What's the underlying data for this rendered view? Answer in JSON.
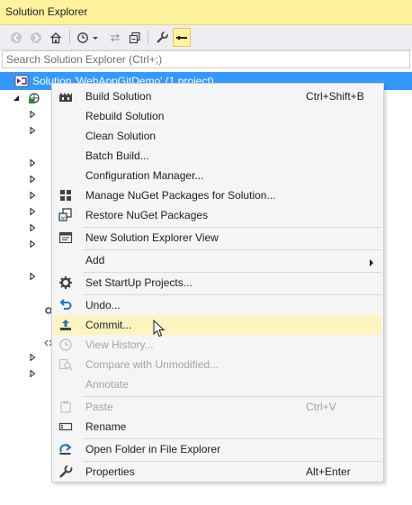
{
  "window": {
    "title": "Solution Explorer"
  },
  "search": {
    "placeholder": "Search Solution Explorer (Ctrl+;)"
  },
  "tree": {
    "root_label": "Solution 'WebAppGitDemo' (1 project)"
  },
  "toolbar": {
    "buttons": [
      "back-icon",
      "forward-icon",
      "home-icon",
      "history-icon",
      "sync-icon",
      "collapse-all-icon",
      "properties-icon",
      "pin-icon"
    ]
  },
  "menu": {
    "items": [
      {
        "label": "Build Solution",
        "shortcut": "Ctrl+Shift+B",
        "icon": "build-icon",
        "enabled": true
      },
      {
        "label": "Rebuild Solution",
        "shortcut": "",
        "icon": "",
        "enabled": true
      },
      {
        "label": "Clean Solution",
        "shortcut": "",
        "icon": "",
        "enabled": true
      },
      {
        "label": "Batch Build...",
        "shortcut": "",
        "icon": "",
        "enabled": true
      },
      {
        "label": "Configuration Manager...",
        "shortcut": "",
        "icon": "",
        "enabled": true
      },
      {
        "label": "Manage NuGet Packages for Solution...",
        "shortcut": "",
        "icon": "nuget-icon",
        "enabled": true
      },
      {
        "label": "Restore NuGet Packages",
        "shortcut": "",
        "icon": "restore-icon",
        "enabled": true
      },
      {
        "label": "New Solution Explorer View",
        "shortcut": "",
        "icon": "new-view-icon",
        "enabled": true
      },
      {
        "label": "Add",
        "shortcut": "",
        "icon": "",
        "enabled": true,
        "submenu": true
      },
      {
        "label": "Set StartUp Projects...",
        "shortcut": "",
        "icon": "gear-icon",
        "enabled": true
      },
      {
        "label": "Undo...",
        "shortcut": "",
        "icon": "undo-icon",
        "enabled": true
      },
      {
        "label": "Commit...",
        "shortcut": "",
        "icon": "commit-icon",
        "enabled": true,
        "hovered": true
      },
      {
        "label": "View History...",
        "shortcut": "",
        "icon": "history-icon",
        "enabled": false
      },
      {
        "label": "Compare with Unmodified...",
        "shortcut": "",
        "icon": "compare-icon",
        "enabled": false
      },
      {
        "label": "Annotate",
        "shortcut": "",
        "icon": "",
        "enabled": false
      },
      {
        "label": "Paste",
        "shortcut": "Ctrl+V",
        "icon": "paste-icon",
        "enabled": false
      },
      {
        "label": "Rename",
        "shortcut": "",
        "icon": "rename-icon",
        "enabled": true
      },
      {
        "label": "Open Folder in File Explorer",
        "shortcut": "",
        "icon": "open-folder-icon",
        "enabled": true
      },
      {
        "label": "Properties",
        "shortcut": "Alt+Enter",
        "icon": "wrench-icon",
        "enabled": true
      }
    ]
  },
  "colors": {
    "title_bar": "#fff29d",
    "selection": "#3399ff",
    "hover": "#fdf4bf"
  }
}
